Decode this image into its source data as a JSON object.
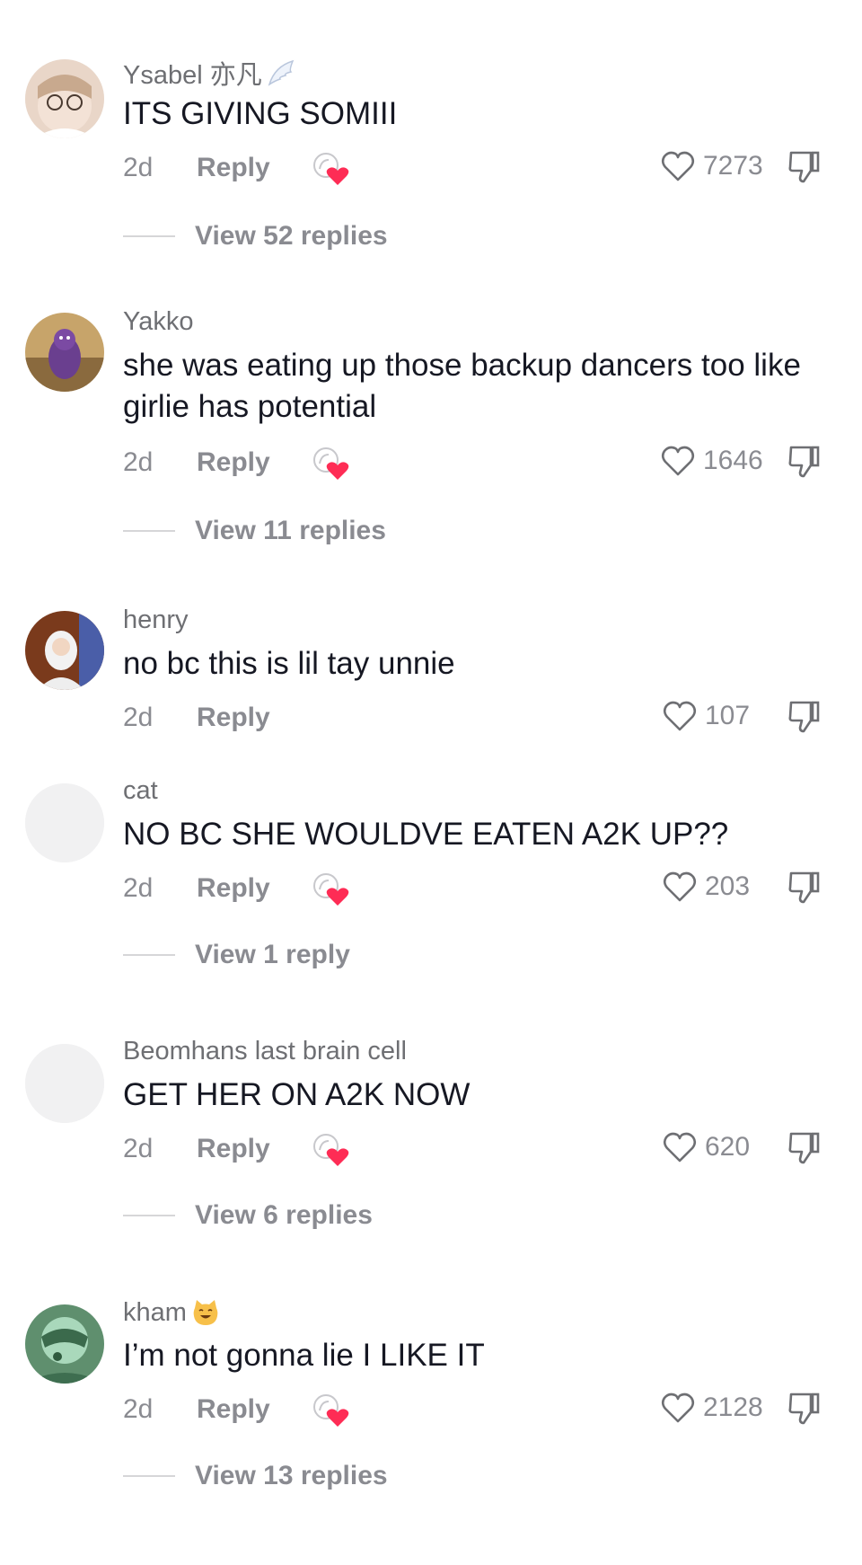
{
  "comments": [
    {
      "author": "Ysabel 亦凡",
      "author_emoji": "wing-emoji",
      "text": "ITS GIVING SOMIII",
      "date": "2d",
      "reply_label": "Reply",
      "creator_liked": true,
      "likes": "7273",
      "view_replies": "View 52 replies"
    },
    {
      "author": "Yakko",
      "text": "she was eating up those backup dancers too like girlie has potential",
      "date": "2d",
      "reply_label": "Reply",
      "creator_liked": true,
      "likes": "1646",
      "view_replies": "View 11 replies"
    },
    {
      "author": "henry",
      "text": "no bc this is lil tay unnie",
      "date": "2d",
      "reply_label": "Reply",
      "creator_liked": false,
      "likes": "107"
    },
    {
      "author": "cat",
      "text": "NO BC SHE WOULDVE EATEN A2K UP??",
      "date": "2d",
      "reply_label": "Reply",
      "creator_liked": true,
      "likes": "203",
      "view_replies": "View 1 reply"
    },
    {
      "author": "Beomhans last brain cell",
      "text": "GET HER ON A2K NOW",
      "date": "2d",
      "reply_label": "Reply",
      "creator_liked": true,
      "likes": "620",
      "view_replies": "View 6 replies"
    },
    {
      "author": "kham",
      "author_emoji": "smiling-cat-emoji",
      "text": "I’m not gonna lie I LIKE IT",
      "date": "2d",
      "reply_label": "Reply",
      "creator_liked": true,
      "likes": "2128",
      "view_replies": "View 13 replies"
    }
  ],
  "colors": {
    "text": "#161823",
    "secondary": "#8a8b91",
    "creator_heart": "#fe2c55"
  }
}
